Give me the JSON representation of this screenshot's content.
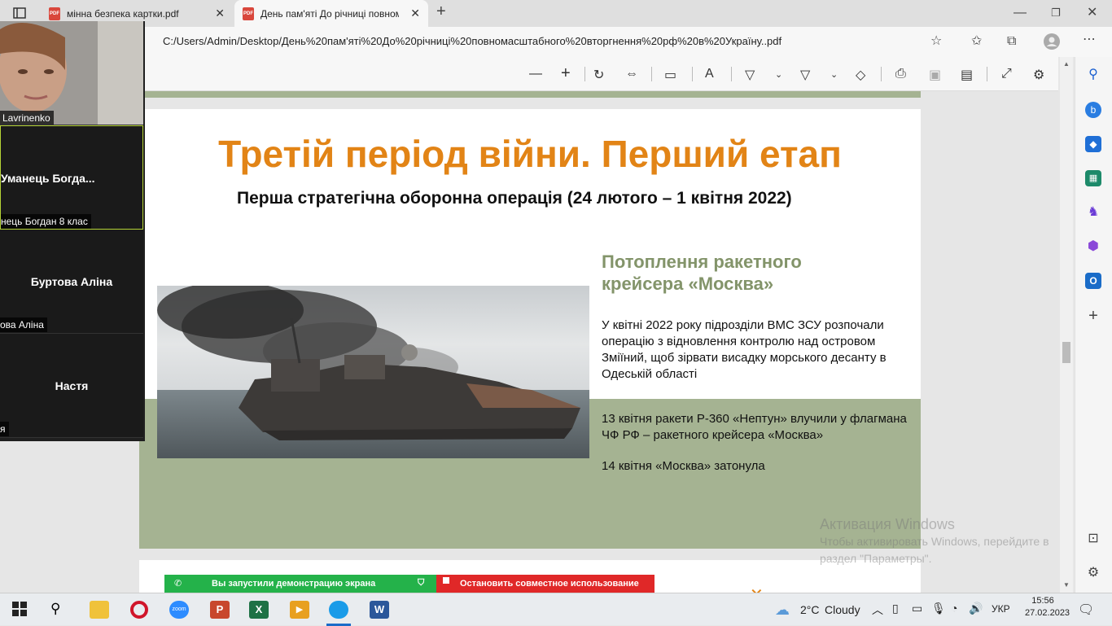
{
  "browser": {
    "tabs": [
      {
        "label": "мінна безпека картки.pdf"
      },
      {
        "label": "День пам'яті До річниці повном"
      }
    ],
    "address": "C:/Users/Admin/Desktop/День%20пам'яті%20До%20річниці%20повномасштабного%20вторгнення%20рф%20в%20Україну..pdf"
  },
  "zoom": {
    "participants": [
      {
        "name": "",
        "label": "Lavrinenko"
      },
      {
        "name": "Уманець  Богда...",
        "label": "нець Богдан 8 клас"
      },
      {
        "name": "Буртова Аліна",
        "label": "ова Аліна"
      },
      {
        "name": "Настя",
        "label": "я"
      }
    ],
    "share_status": "Вы запустили демонстрацию экрана",
    "stop_share": "Остановить совместное использование"
  },
  "slide": {
    "title": "Третій період війни. Перший етап",
    "subtitle": "Перша стратегічна оборонна операція (24 лютого – 1 квітня 2022)",
    "section_heading_1": "Потоплення ракетного",
    "section_heading_2": "крейсера «Москва»",
    "para1": "У квітні 2022 року підрозділи ВМС ЗСУ розпочали операцію з відновлення контролю над островом Зміїний, щоб зірвати висадку морського десанту в Одеській області",
    "para2": "13 квітня ракети Р-360 «Нептун» влучили у флагмана ЧФ РФ – ракетного крейсера «Москва»",
    "para3": "14 квітня «Москва» затонула"
  },
  "watermark": {
    "line1": "Активация Windows",
    "line2": "Чтобы активировать Windows, перейдите в",
    "line3": "раздел \"Параметры\"."
  },
  "taskbar": {
    "temp": "2°C",
    "weather": "Cloudy",
    "lang": "УКР",
    "time": "15:56",
    "date": "27.02.2023"
  },
  "colors": {
    "accent_orange": "#e28416",
    "slide_green": "#a5b392",
    "heading_green": "#83946a"
  }
}
